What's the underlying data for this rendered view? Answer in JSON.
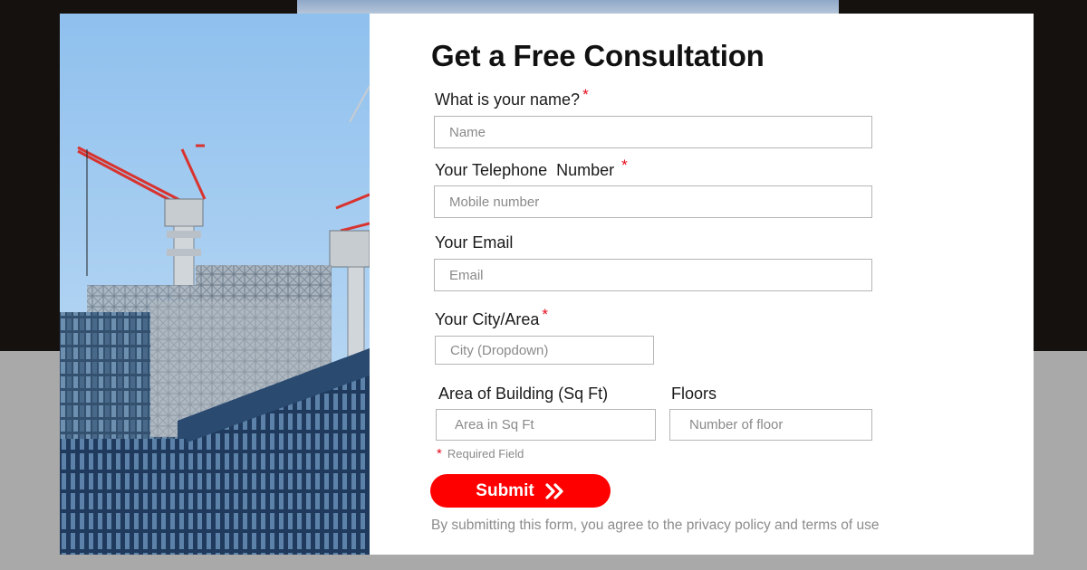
{
  "form": {
    "title": "Get a Free Consultation",
    "required_mark": "*",
    "name": {
      "label": "What is your name?",
      "placeholder": "Name",
      "value": ""
    },
    "phone": {
      "label": "Your Telephone  Number",
      "placeholder": "Mobile number",
      "value": ""
    },
    "email": {
      "label": "Your Email",
      "placeholder": "Email",
      "value": ""
    },
    "city": {
      "label": "Your City/Area",
      "placeholder": "City (Dropdown)",
      "value": ""
    },
    "area": {
      "label": "Area of Building (Sq Ft)",
      "placeholder": "Area in Sq Ft",
      "value": ""
    },
    "floors": {
      "label": "Floors",
      "placeholder": "Number of floor",
      "value": ""
    },
    "required_note": "Required Field",
    "submit_label": "Submit",
    "disclaimer": "By submitting this form, you agree to the privacy policy and terms of use"
  },
  "colors": {
    "accent": "#ff0000",
    "required": "#e5091a",
    "input_border": "#b5b5b5",
    "backdrop_dark": "#14110f",
    "backdrop_grey": "#a9a9a9"
  },
  "icons": {
    "submit": "double-chevron-right-icon"
  }
}
